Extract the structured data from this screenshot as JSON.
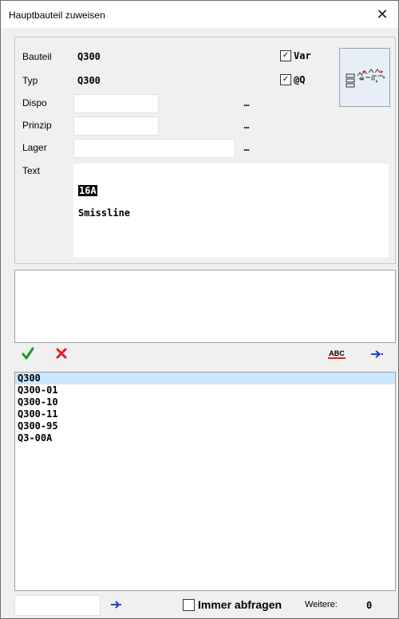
{
  "window": {
    "title": "Hauptbauteil zuweisen",
    "close_glyph": "✕"
  },
  "form": {
    "bauteil_label": "Bauteil",
    "bauteil_value": "Q300",
    "typ_label": "Typ",
    "typ_value": "Q300",
    "dispo_label": "Dispo",
    "dispo_value": "",
    "dispo_browse": "...",
    "prinzip_label": "Prinzip",
    "prinzip_value": "",
    "prinzip_browse": "...",
    "lager_label": "Lager",
    "lager_value": "",
    "lager_browse": "...",
    "text_label": "Text",
    "text_line1": "16A",
    "text_line2": "Smissline"
  },
  "options": {
    "var_label": "Var",
    "var_checked": true,
    "atq_label": "@Q",
    "atq_checked": true,
    "check_glyph": "✓"
  },
  "toolbar": {
    "ok_icon": "checkmark-icon",
    "cancel_icon": "red-x-icon",
    "spellcheck_label": "ABC",
    "next_icon": "arrow-right-dotted-icon"
  },
  "list": {
    "items": [
      "Q300",
      "Q300-01",
      "Q300-10",
      "Q300-11",
      "Q300-95",
      "Q3-00A"
    ],
    "selected_index": 0
  },
  "footer": {
    "search_value": "",
    "go_icon": "arrow-right-icon",
    "immer_label": "Immer abfragen",
    "immer_checked": false,
    "weitere_label": "Weitere:",
    "weitere_value": "0"
  },
  "colors": {
    "check_green": "#1a9a1a",
    "cross_red": "#e02020",
    "arrow_blue": "#1f3fd0",
    "selection": "#cce8ff"
  }
}
